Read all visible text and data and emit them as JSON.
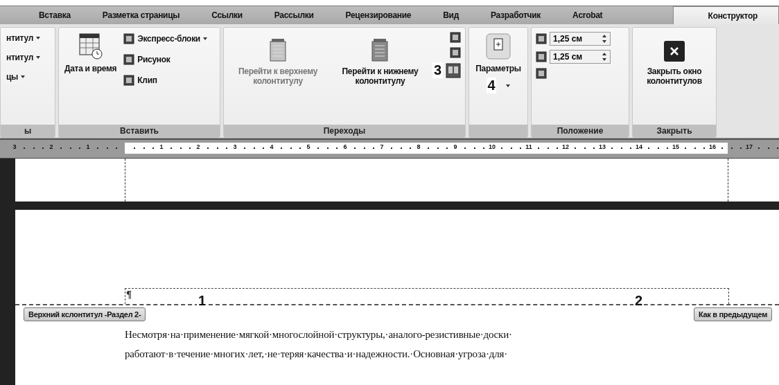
{
  "tabs": [
    {
      "label": "Вставка",
      "selected": false
    },
    {
      "label": "Разметка страницы",
      "selected": false
    },
    {
      "label": "Ссылки",
      "selected": false
    },
    {
      "label": "Рассылки",
      "selected": false
    },
    {
      "label": "Рецензирование",
      "selected": false
    },
    {
      "label": "Вид",
      "selected": false
    },
    {
      "label": "Разработчик",
      "selected": false
    },
    {
      "label": "Acrobat",
      "selected": false
    },
    {
      "label": "Конструктор",
      "selected": true
    }
  ],
  "ribbon": {
    "groups": [
      {
        "kind": "partial",
        "label": "ы",
        "items": [
          {
            "label": "нтитул",
            "dropdown": true
          },
          {
            "label": "нтитул",
            "dropdown": true
          },
          {
            "label": "цы",
            "dropdown": true
          }
        ]
      },
      {
        "kind": "insert",
        "label": "Вставить",
        "large": {
          "label": "Дата и время"
        },
        "items": [
          {
            "label": "Экспресс-блоки",
            "dropdown": true
          },
          {
            "label": "Рисунок",
            "dropdown": false
          },
          {
            "label": "Клип",
            "dropdown": false
          }
        ]
      },
      {
        "kind": "navigation",
        "label": "Переходы",
        "buttons": [
          {
            "label": "Перейти к верхнему колонтитулу",
            "disabled": true
          },
          {
            "label": "Перейти к нижнему колонтитулу",
            "disabled": false
          }
        ],
        "callout": "3"
      },
      {
        "kind": "options",
        "button": {
          "label": "Параметры",
          "dropdown": true
        },
        "callout": "4"
      },
      {
        "kind": "position",
        "label": "Положение",
        "spinners": [
          {
            "value": "1,25 см"
          },
          {
            "value": "1,25 см"
          }
        ]
      },
      {
        "kind": "close",
        "label": "Закрыть",
        "button": {
          "label": "Закрыть окно колонтитулов"
        }
      }
    ]
  },
  "ruler": {
    "left_labels": [
      "3",
      "2",
      "1"
    ],
    "right_labels": [
      "1",
      "2",
      "3",
      "4",
      "5",
      "6",
      "7",
      "8",
      "9",
      "10",
      "11",
      "12",
      "13",
      "14",
      "15",
      "16",
      "17"
    ]
  },
  "document": {
    "pilcrow": "¶",
    "header_tag": "Верхний кслонтитул -Раздел 2-",
    "link_tag": "Как в предыдущем",
    "callouts": [
      "1",
      "2"
    ],
    "lines": [
      "Несмотря·на·применение·мягкой·многослойной·структуры,·аналого-резистивные·доски·",
      "работают·в·течение·многих·лет,·не·теряя·качества·и·надежности.·Основная·угроза·для·"
    ]
  }
}
